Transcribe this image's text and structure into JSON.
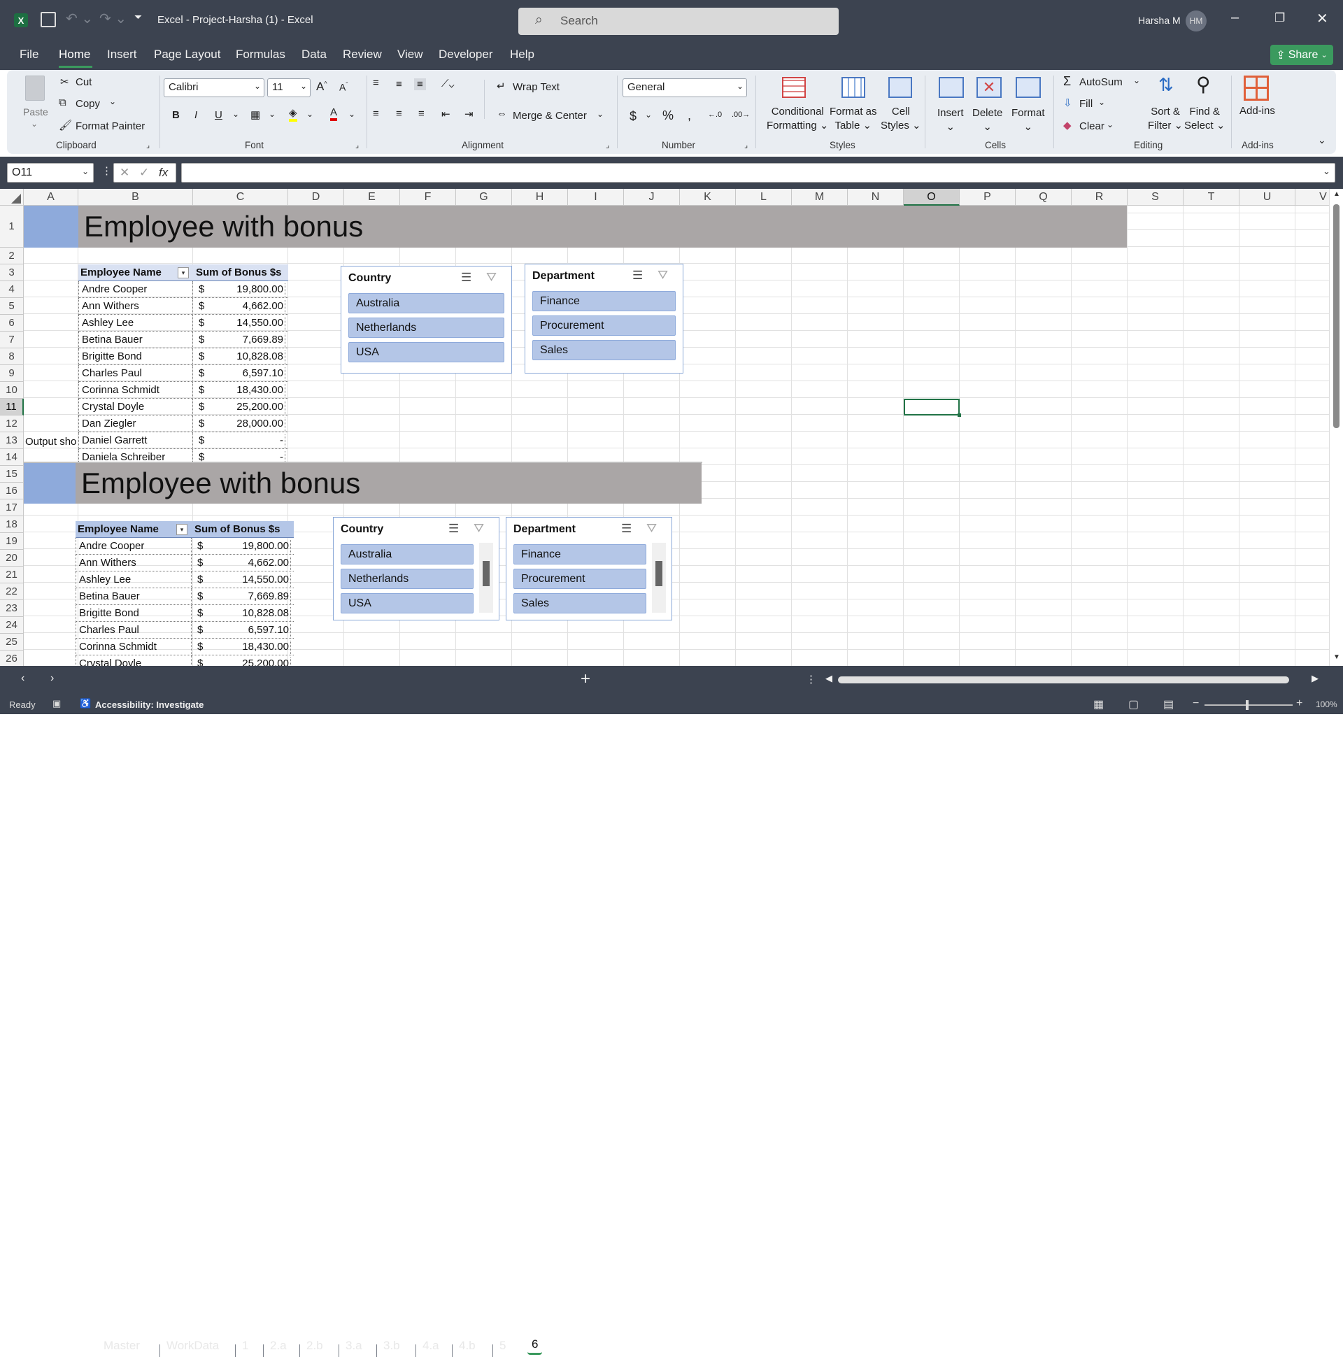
{
  "titlebar": {
    "title": "Excel - Project-Harsha (1)  -  Excel",
    "search_placeholder": "Search",
    "user": "Harsha M",
    "initials": "HM"
  },
  "menu": {
    "file": "File",
    "home": "Home",
    "insert": "Insert",
    "page_layout": "Page Layout",
    "formulas": "Formulas",
    "data": "Data",
    "review": "Review",
    "view": "View",
    "developer": "Developer",
    "help": "Help",
    "share": "Share"
  },
  "ribbon": {
    "clipboard": {
      "paste": "Paste",
      "cut": "Cut",
      "copy": "Copy",
      "format_painter": "Format Painter",
      "group": "Clipboard"
    },
    "font": {
      "name": "Calibri",
      "size": "11",
      "group": "Font"
    },
    "alignment": {
      "wrap": "Wrap Text",
      "merge": "Merge & Center",
      "group": "Alignment"
    },
    "number": {
      "format": "General",
      "group": "Number"
    },
    "styles": {
      "cond1": "Conditional",
      "cond2": "Formatting",
      "fat1": "Format as",
      "fat2": "Table",
      "cs1": "Cell",
      "cs2": "Styles",
      "group": "Styles"
    },
    "cells": {
      "insert": "Insert",
      "delete": "Delete",
      "format": "Format",
      "group": "Cells"
    },
    "editing": {
      "autosum": "AutoSum",
      "fill": "Fill",
      "clear": "Clear",
      "sort1": "Sort &",
      "sort2": "Filter",
      "find1": "Find &",
      "find2": "Select",
      "group": "Editing"
    },
    "addins": {
      "label": "Add-ins",
      "group": "Add-ins"
    }
  },
  "formula_bar": {
    "name_box": "O11",
    "fx": "fx",
    "content": ""
  },
  "columns": [
    "A",
    "B",
    "C",
    "D",
    "E",
    "F",
    "G",
    "H",
    "I",
    "J",
    "K",
    "L",
    "M",
    "N",
    "O",
    "P",
    "Q",
    "R",
    "S",
    "T",
    "U",
    "V"
  ],
  "rows": [
    "1",
    "2",
    "3",
    "4",
    "5",
    "6",
    "7",
    "8",
    "9",
    "10",
    "11",
    "12",
    "13",
    "14",
    "15",
    "16",
    "17",
    "18",
    "19",
    "20",
    "21",
    "22",
    "23",
    "24",
    "25",
    "26"
  ],
  "top": {
    "title": "Employee with bonus",
    "hdr_name": "Employee Name",
    "hdr_sum": "Sum of Bonus $s",
    "rows": [
      {
        "n": "Andre Cooper",
        "c": "$",
        "v": "19,800.00"
      },
      {
        "n": "Ann Withers",
        "c": "$",
        "v": "4,662.00"
      },
      {
        "n": "Ashley Lee",
        "c": "$",
        "v": "14,550.00"
      },
      {
        "n": "Betina Bauer",
        "c": "$",
        "v": "7,669.89"
      },
      {
        "n": "Brigitte Bond",
        "c": "$",
        "v": "10,828.08"
      },
      {
        "n": "Charles Paul",
        "c": "$",
        "v": "6,597.10"
      },
      {
        "n": "Corinna Schmidt",
        "c": "$",
        "v": "18,430.00"
      },
      {
        "n": "Crystal Doyle",
        "c": "$",
        "v": "25,200.00"
      },
      {
        "n": "Dan Ziegler",
        "c": "$",
        "v": "28,000.00"
      },
      {
        "n": "Daniel Garrett",
        "c": "$",
        "v": "-"
      },
      {
        "n": "Daniela Schreiber",
        "c": "$",
        "v": "-"
      }
    ],
    "note": "Output sho",
    "slicer_country": {
      "title": "Country",
      "items": [
        "Australia",
        "Netherlands",
        "USA"
      ]
    },
    "slicer_dept": {
      "title": "Department",
      "items": [
        "Finance",
        "Procurement",
        "Sales"
      ]
    }
  },
  "bottom": {
    "title": "Employee with bonus",
    "hdr_name": "Employee Name",
    "hdr_sum": "Sum of Bonus $s",
    "rows": [
      {
        "n": "Andre Cooper",
        "c": "$",
        "v": "19,800.00"
      },
      {
        "n": "Ann Withers",
        "c": "$",
        "v": "4,662.00"
      },
      {
        "n": "Ashley Lee",
        "c": "$",
        "v": "14,550.00"
      },
      {
        "n": "Betina Bauer",
        "c": "$",
        "v": "7,669.89"
      },
      {
        "n": "Brigitte Bond",
        "c": "$",
        "v": "10,828.08"
      },
      {
        "n": "Charles Paul",
        "c": "$",
        "v": "6,597.10"
      },
      {
        "n": "Corinna Schmidt",
        "c": "$",
        "v": "18,430.00"
      },
      {
        "n": "Crystal Doyle",
        "c": "$",
        "v": "25,200.00"
      }
    ],
    "slicer_country": {
      "title": "Country",
      "items": [
        "Australia",
        "Netherlands",
        "USA"
      ]
    },
    "slicer_dept": {
      "title": "Department",
      "items": [
        "Finance",
        "Procurement",
        "Sales"
      ]
    }
  },
  "sheets": [
    "Master",
    "WorkData",
    "1",
    "2.a",
    "2.b",
    "3.a",
    "3.b",
    "4.a",
    "4.b",
    "5",
    "6"
  ],
  "active_sheet": "6",
  "status": {
    "ready": "Ready",
    "accessibility": "Accessibility: Investigate",
    "zoom": "100%"
  }
}
